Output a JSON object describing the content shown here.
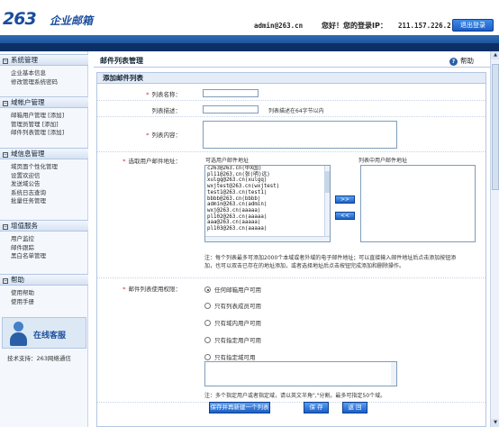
{
  "header": {
    "logo_mark": "263",
    "logo_text": "企业邮箱",
    "user": "admin@263.cn",
    "greeting": "您好！您的登录IP：",
    "ip": "211.157.226.2",
    "logout_label": "退出登录"
  },
  "sidebar": {
    "sections": [
      {
        "title": "系统管理",
        "items": [
          "企业基本信息",
          "修改管理系统密码"
        ]
      },
      {
        "title": "域帐户管理",
        "items": [
          "邮箱用户管理 [添加]",
          "管理员管理   [添加]",
          "邮件列表管理 [添加]"
        ]
      },
      {
        "title": "域信息管理",
        "items": [
          "域页面个性化管理",
          "设置欢迎信",
          "发送域公告",
          "系统日志查询",
          "批量任务管理"
        ]
      },
      {
        "title": "增值服务",
        "items": [
          "用户监控",
          "邮件跟踪",
          "黑白名单管理"
        ]
      },
      {
        "title": "帮助",
        "items": [
          "使用帮助",
          "使用手册"
        ]
      }
    ],
    "service_label": "在线客服",
    "support_text": "技术支持：263网络通信"
  },
  "main": {
    "page_title": "邮件列表管理",
    "help_label": "帮助",
    "form_title": "添加邮件列表",
    "fields": {
      "list_name_label": "列表名称：",
      "list_name_value": "",
      "list_desc_label": "列表描述：",
      "list_desc_value": "",
      "list_desc_hint": "列表描述在64字节以内",
      "list_content_label": "列表内容：",
      "select_label": "选取用户邮件地址：",
      "available_header": "可选用户邮件地址",
      "selected_header": "列表中用户邮件地址",
      "available_addresses": [
        "c263@263.cn(中X国)",
        "pl11@263.cn(张(明)远)",
        "xulgq@263.cn(xulgq)",
        "wxjtest@263.cn(wxjtest)",
        "test1@263.cn(test1)",
        "bbbb@263.cn(bbbb)",
        "admin@263.cn(admin)",
        "wxj@263.cn(aaaaa)",
        "pl102@263.cn(aaaaa)",
        "aaa@263.cn(aaaaa)",
        "pl103@263.cn(aaaaa)"
      ],
      "selected_addresses": [],
      "add_btn": ">>",
      "remove_btn": "<<",
      "note1": "注：每个列表最多可添加2000个本域或者外域的电子邮件地址；可以直接输入邮件地址后点击添加按钮添",
      "note2": "加，也可以双击已存在的地址添加，或者选择地址后点击按钮完成添加和删除操作。",
      "permission_label": "邮件列表使用权限：",
      "permission_options": [
        "任何邮箱用户可用",
        "只有列表成员可用",
        "只有域内用户可用",
        "只有指定用户可用",
        "只有指定域可用"
      ],
      "permission_selected": 0,
      "domain_note": "注：多个指定用户或者指定域，请以英文半角\",\"分割。最多可指定50个域。"
    },
    "buttons": {
      "save_continue": "保存并再新建一个列表",
      "save": "保 存",
      "back": "返 回"
    }
  }
}
